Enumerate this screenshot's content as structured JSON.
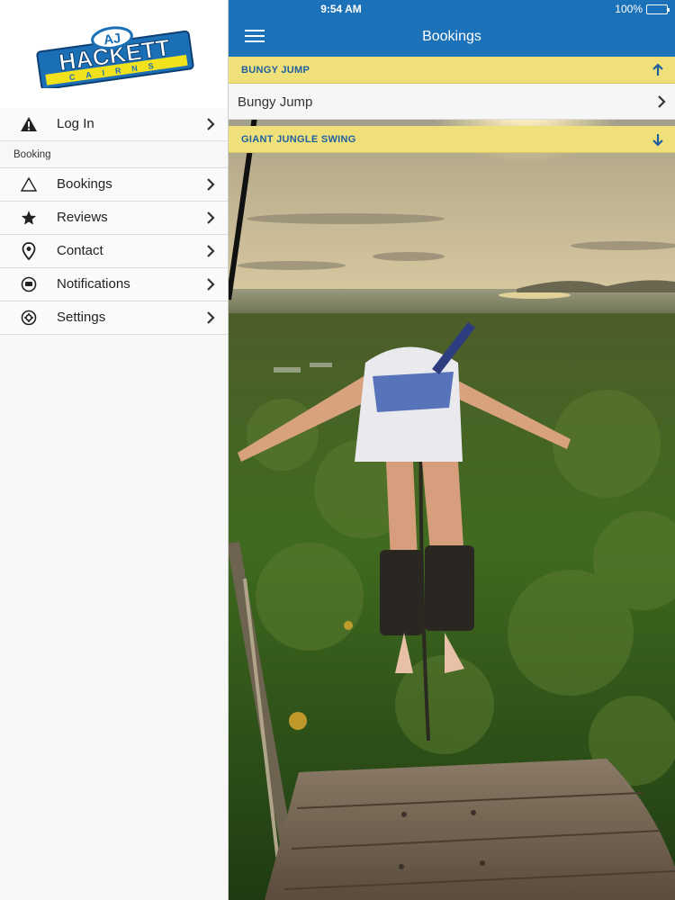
{
  "status": {
    "time": "9:54 AM",
    "battery": "100%"
  },
  "header": {
    "title": "Bookings"
  },
  "logo": {
    "top": "HACKETT",
    "bottom": "CAIRNS",
    "mark": "AJ"
  },
  "sidebar": {
    "login": {
      "label": "Log In",
      "icon": "warning-icon"
    },
    "section": "Booking",
    "items": [
      {
        "label": "Bookings",
        "icon": "triangle-icon"
      },
      {
        "label": "Reviews",
        "icon": "star-icon"
      },
      {
        "label": "Contact",
        "icon": "location-pin-icon"
      },
      {
        "label": "Notifications",
        "icon": "chat-bubble-icon"
      },
      {
        "label": "Settings",
        "icon": "gear-icon"
      }
    ]
  },
  "accordion": [
    {
      "header": "BUNGY JUMP",
      "expanded": true,
      "items": [
        "Bungy Jump"
      ]
    },
    {
      "header": "GIANT JUNGLE SWING",
      "expanded": false,
      "items": []
    }
  ],
  "colors": {
    "navbar": "#1c72b8",
    "accordion_header": "#f0e07a",
    "accordion_text": "#1f5fa0"
  }
}
